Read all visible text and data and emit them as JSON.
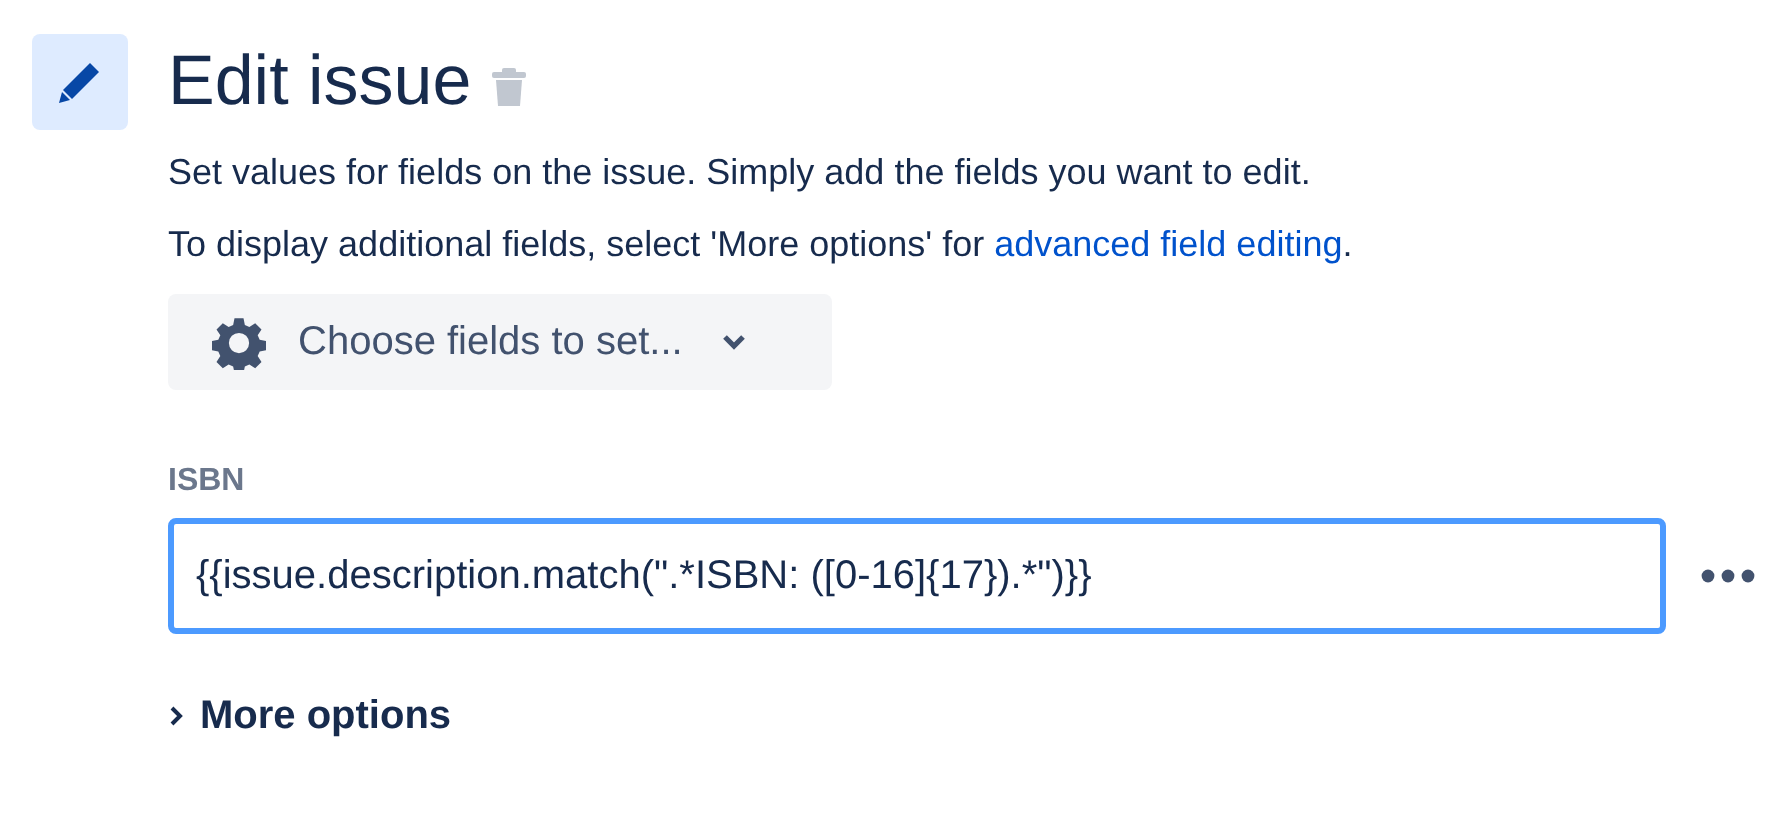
{
  "header": {
    "title": "Edit issue"
  },
  "description": "Set values for fields on the issue. Simply add the fields you want to edit.",
  "hint": {
    "text": "To display additional fields, select 'More options' for ",
    "link": "advanced field editing",
    "suffix": "."
  },
  "chooser": {
    "label": "Choose fields to set..."
  },
  "fields": [
    {
      "label": "ISBN",
      "value": "{{issue.description.match(\".*ISBN: ([0-16]{17}).*\")}}",
      "focused": true
    }
  ],
  "more_options": {
    "label": "More options",
    "expanded": false
  }
}
